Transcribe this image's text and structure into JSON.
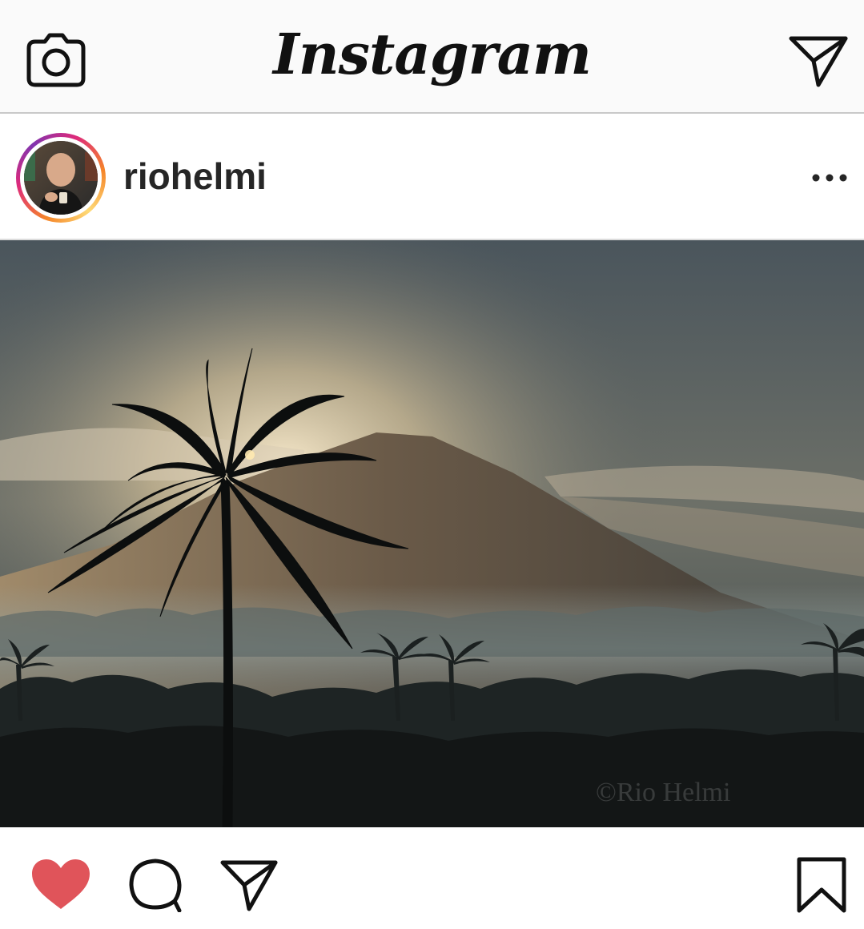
{
  "topbar": {
    "brand": "Instagram",
    "camera_icon": "camera-icon",
    "direct_icon": "paper-plane-icon"
  },
  "post": {
    "username": "riohelmi",
    "avatar_icon": "user-avatar",
    "more_icon": "more-horizontal-icon",
    "image_watermark": "©Rio Helmi",
    "liked": true
  },
  "actions": {
    "like_icon": "heart-icon",
    "comment_icon": "comment-icon",
    "share_icon": "paper-plane-icon",
    "save_icon": "bookmark-icon"
  },
  "colors": {
    "like_red": "#e0545a",
    "text": "#262626",
    "divider": "#c9c9c9"
  }
}
